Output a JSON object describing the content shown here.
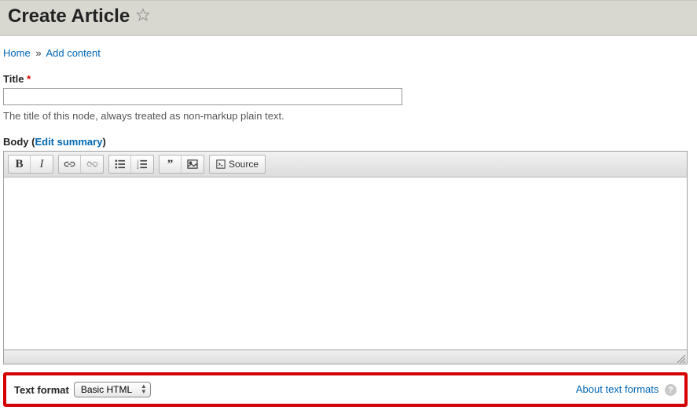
{
  "header": {
    "title": "Create Article"
  },
  "breadcrumb": {
    "home": "Home",
    "sep": "»",
    "add_content": "Add content"
  },
  "title_field": {
    "label": "Title",
    "value": "",
    "hint": "The title of this node, always treated as non-markup plain text."
  },
  "body_field": {
    "label": "Body",
    "edit_summary": "Edit summary"
  },
  "toolbar": {
    "bold": "B",
    "italic": "I",
    "source": "Source"
  },
  "text_format": {
    "label": "Text format",
    "selected": "Basic HTML",
    "about": "About text formats",
    "help": "?"
  }
}
